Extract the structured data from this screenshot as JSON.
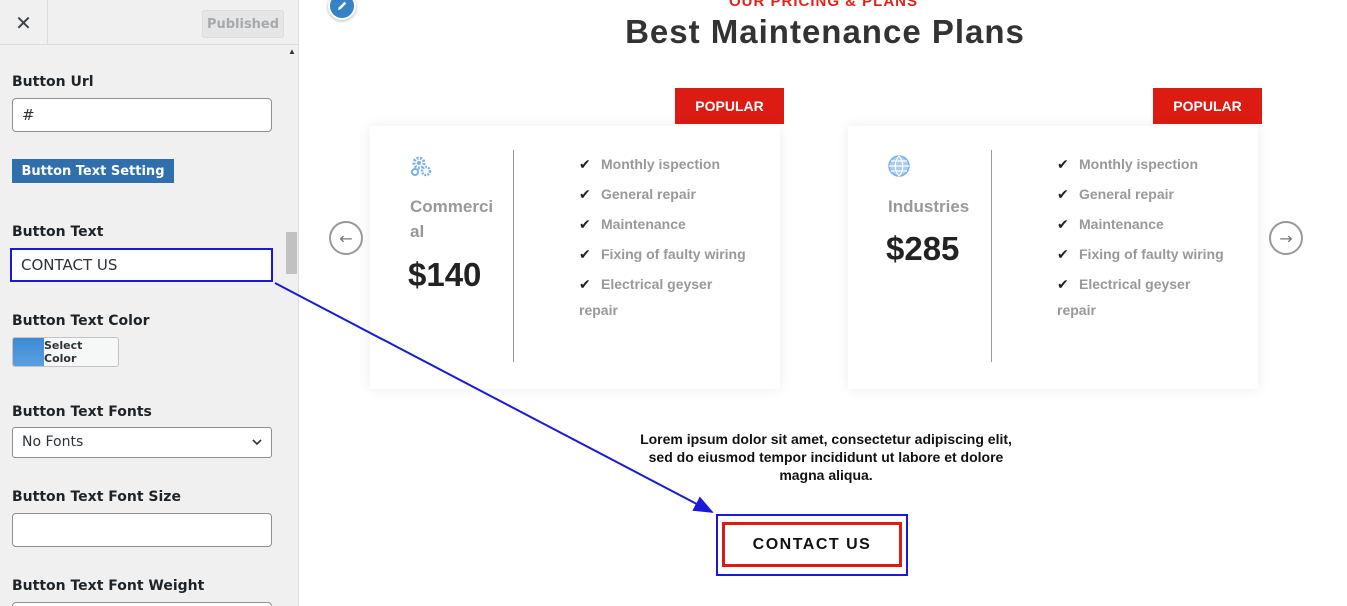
{
  "sidebar": {
    "close_symbol": "✕",
    "published_label": "Published",
    "fields": {
      "button_url_label": "Button Url",
      "button_url_value": "#",
      "section_button_label": "Button Text Setting",
      "button_text_label": "Button Text",
      "button_text_value": "CONTACT US",
      "button_text_color_label": "Button Text Color",
      "select_color_label": "Select Color",
      "button_text_fonts_label": "Button Text Fonts",
      "button_text_fonts_value": "No Fonts",
      "button_text_font_size_label": "Button Text Font Size",
      "button_text_font_size_value": "",
      "button_text_font_weight_label": "Button Text Font Weight"
    }
  },
  "preview": {
    "eyebrow": "OUR PRICING & PLANS",
    "title": "Best Maintenance Plans",
    "cards": [
      {
        "badge": "POPULAR",
        "icon": "gears-icon",
        "name": "Commerci al",
        "price": "$140",
        "features": [
          "Monthly ispection",
          "General repair",
          "Maintenance",
          "Fixing of faulty wiring",
          "Electrical geyser repair"
        ]
      },
      {
        "badge": "POPULAR",
        "icon": "globe-icon",
        "name": "Industries",
        "price": "$285",
        "features": [
          "Monthly ispection",
          "General repair",
          "Maintenance",
          "Fixing of faulty wiring",
          "Electrical geyser repair"
        ]
      }
    ],
    "prev_arrow": "←",
    "next_arrow": "→",
    "blurb": "Lorem ipsum dolor sit amet, consectetur adipiscing elit, sed do eiusmod tempor incididunt ut labore et dolore magna aliqua.",
    "cta_label": "CONTACT US"
  },
  "colors": {
    "accent_red": "#dc1c13",
    "highlight_blue": "#1a1ad6",
    "section_button_blue": "#2f6fad"
  }
}
